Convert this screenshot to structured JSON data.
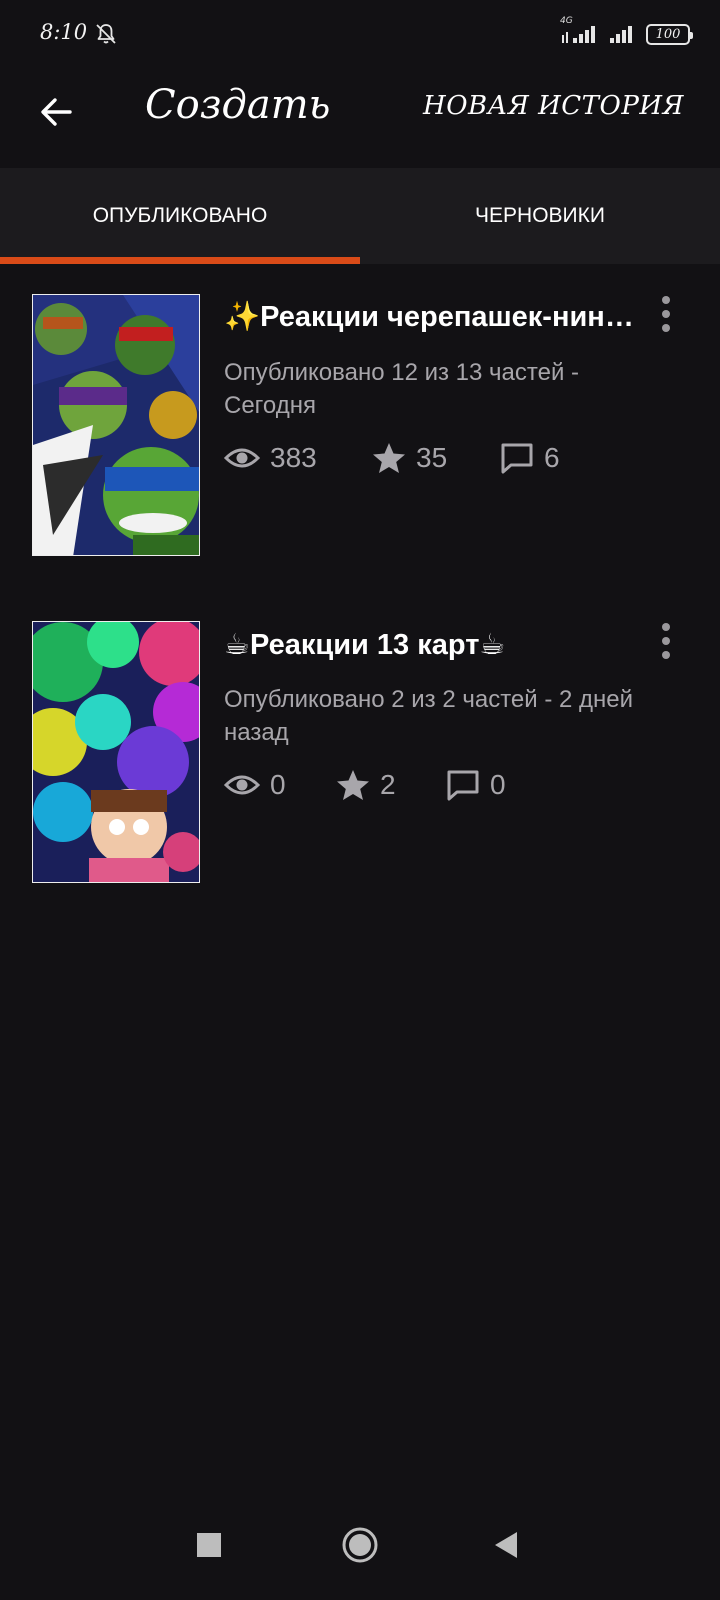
{
  "status_bar": {
    "time": "8:10",
    "network_type": "4G",
    "battery": "100"
  },
  "app_bar": {
    "title": "Создать",
    "new_story": "НОВАЯ ИСТОРИЯ"
  },
  "tabs": [
    {
      "label": "ОПУБЛИКОВАНО",
      "selected": true
    },
    {
      "label": "ЧЕРНОВИКИ",
      "selected": false
    }
  ],
  "stories": [
    {
      "title": "✨Реакции черепашек-ниндзя✨",
      "meta": "Опубликовано 12 из 13 частей - Сегодня",
      "views": "383",
      "votes": "35",
      "comments": "6"
    },
    {
      "title": "☕Реакции 13 карт☕",
      "meta": "Опубликовано 2 из 2 частей - 2 дней назад",
      "views": "0",
      "votes": "2",
      "comments": "0"
    }
  ],
  "colors": {
    "background": "#121114",
    "tab_bar": "#1c1b1e",
    "accent": "#d94b18",
    "secondary_text": "#a8a6ab"
  },
  "icons": [
    "bell-off-icon",
    "signal-icon",
    "battery-icon",
    "back-arrow-icon",
    "eye-icon",
    "star-icon",
    "comment-icon",
    "more-vert-icon",
    "nav-recents-icon",
    "nav-home-icon",
    "nav-back-icon"
  ]
}
